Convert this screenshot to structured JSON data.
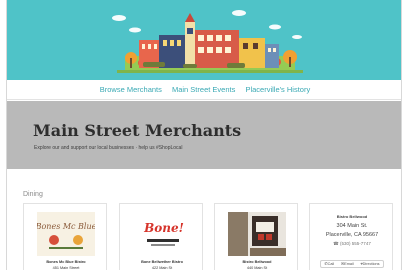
{
  "nav": {
    "links": [
      "Browse Merchants",
      "Main Street Events",
      "Placerville's History"
    ]
  },
  "banner": {
    "title": "Main Street Merchants",
    "subtitle": "Explore our and support our local businesses · help us #ShopLocal"
  },
  "section": {
    "title": "Dining"
  },
  "cards": [
    {
      "logo_text": "Bones Mc Blue",
      "name": "Bones Mc Blue Bistro",
      "address": "451 Main Street"
    },
    {
      "logo_text": "Bone!",
      "name": "Bone Bellwether Bistro",
      "address": "422 Main St"
    },
    {
      "logo_text": "",
      "name": "Bistro Bellwood",
      "address": "440 Main St"
    }
  ],
  "contact_card": {
    "name": "Bistro Bellwood",
    "street": "304 Main St.",
    "city": "Placerville, CA 95667",
    "phone": "(530) 555-7747",
    "actions": [
      "Call",
      "Email",
      "Directions"
    ]
  },
  "colors": {
    "hero_bg": "#4fc3c8",
    "nav_link": "#3aa9b4",
    "banner_bg": "#b9b9b9"
  }
}
